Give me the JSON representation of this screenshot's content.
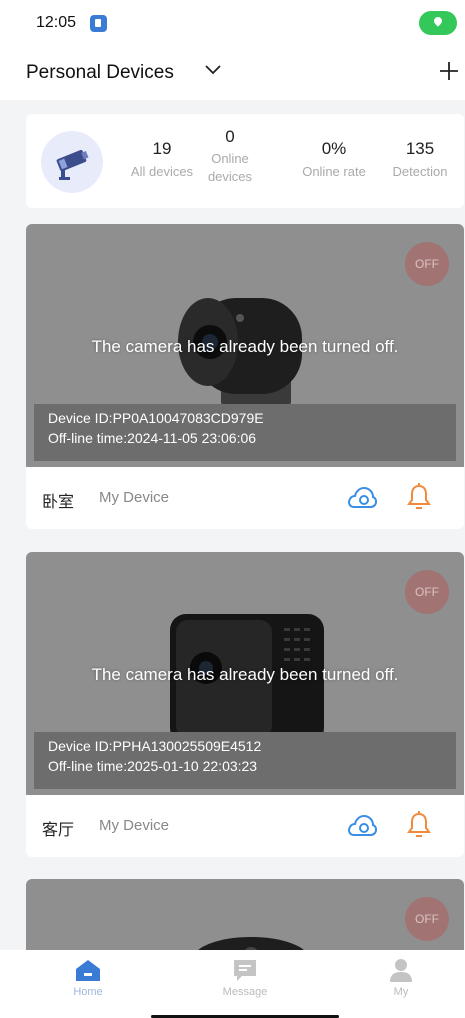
{
  "status": {
    "time": "12:05"
  },
  "header": {
    "title": "Personal Devices"
  },
  "summary": {
    "all_devices": {
      "value": "19",
      "label": "All devices"
    },
    "online_devices": {
      "value": "0",
      "label_line1": "Online",
      "label_line2": "devices"
    },
    "online_rate": {
      "value": "0%",
      "label": "Online rate"
    },
    "detection": {
      "value": "135",
      "label": "Detection"
    }
  },
  "devices": [
    {
      "off_badge": "OFF",
      "message": "The camera has already been turned off.",
      "device_id": "Device ID:PP0A10047083CD979E",
      "offline_time": "Off-line time:2024-11-05 23:06:06",
      "room": "卧室",
      "type": "My Device"
    },
    {
      "off_badge": "OFF",
      "message": "The camera has already been turned off.",
      "device_id": "Device ID:PPHA130025509E4512",
      "offline_time": "Off-line time:2025-01-10 22:03:23",
      "room": "客厅",
      "type": "My Device"
    },
    {
      "off_badge": "OFF"
    }
  ],
  "tabs": [
    {
      "label": "Home",
      "icon": "home-icon",
      "active": true
    },
    {
      "label": "Message",
      "icon": "message-icon",
      "active": false
    },
    {
      "label": "My",
      "icon": "person-icon",
      "active": false
    }
  ],
  "colors": {
    "accent": "#3a7bd5",
    "bell": "#f08a3c",
    "cloud": "#3a8ee6",
    "preview_bg": "#8f8f8f",
    "online_pill": "#34c759"
  }
}
